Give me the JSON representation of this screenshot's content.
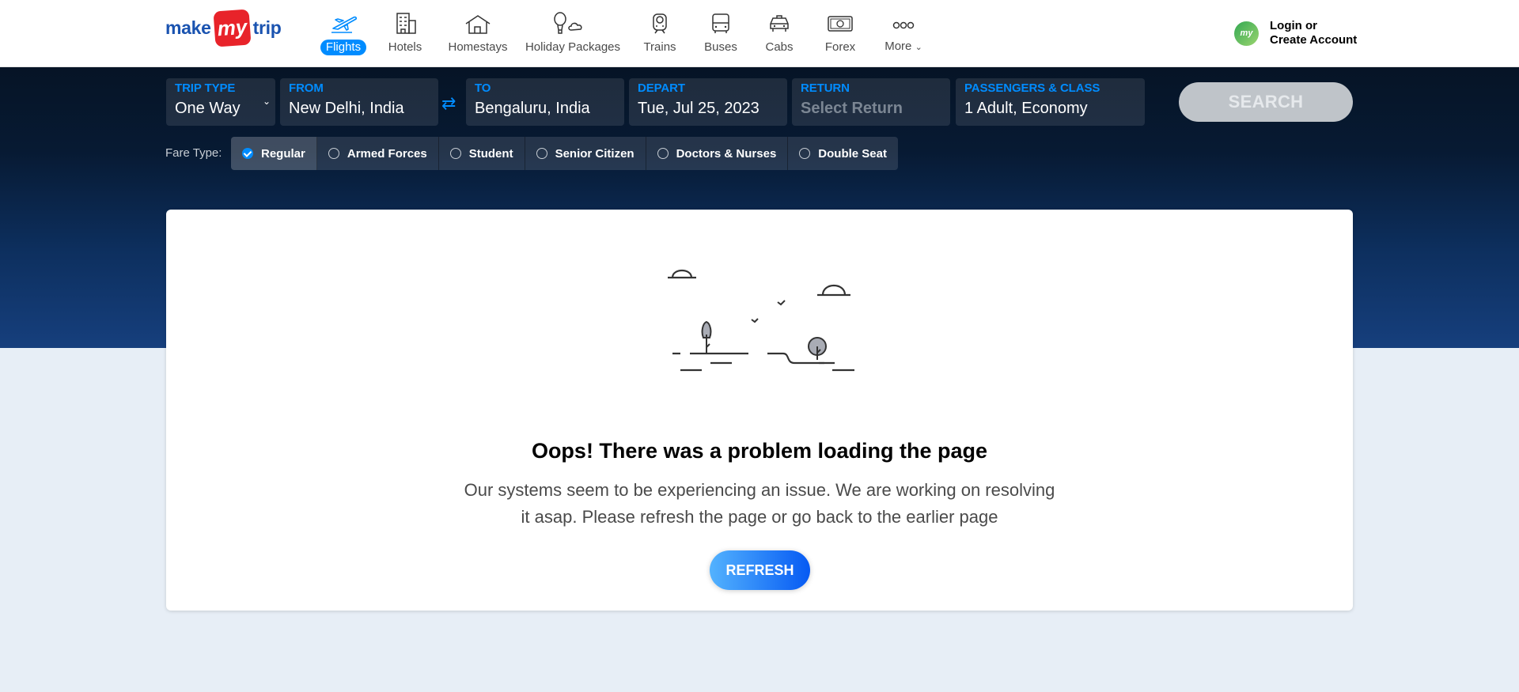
{
  "header": {
    "logo": {
      "make": "make",
      "my": "my",
      "trip": "trip"
    },
    "nav": [
      {
        "label": "Flights",
        "icon": "flight-icon",
        "active": true
      },
      {
        "label": "Hotels",
        "icon": "hotel-icon"
      },
      {
        "label": "Homestays",
        "icon": "homestay-icon"
      },
      {
        "label": "Holiday Packages",
        "icon": "holiday-packages-icon"
      },
      {
        "label": "Trains",
        "icon": "train-icon"
      },
      {
        "label": "Buses",
        "icon": "bus-icon"
      },
      {
        "label": "Cabs",
        "icon": "cab-icon"
      },
      {
        "label": "Forex",
        "icon": "forex-icon"
      },
      {
        "label": "More",
        "icon": "more-icon"
      }
    ],
    "account": {
      "avatar": "my",
      "line1": "Login or",
      "line2": "Create Account"
    }
  },
  "search": {
    "trip_type": {
      "label": "TRIP TYPE",
      "value": "One Way"
    },
    "from": {
      "label": "FROM",
      "value": "New Delhi, India"
    },
    "swap": "⇄",
    "to": {
      "label": "TO",
      "value": "Bengaluru, India"
    },
    "depart": {
      "label": "DEPART",
      "value": "Tue, Jul 25, 2023"
    },
    "return": {
      "label": "RETURN",
      "placeholder": "Select Return"
    },
    "passengers": {
      "label": "PASSENGERS & CLASS",
      "value": "1 Adult, Economy"
    },
    "button": "SEARCH"
  },
  "fare": {
    "label": "Fare Type:",
    "options": [
      "Regular",
      "Armed Forces",
      "Student",
      "Senior Citizen",
      "Doctors & Nurses",
      "Double Seat"
    ],
    "selected": "Regular"
  },
  "error": {
    "title": "Oops! There was a problem loading the page",
    "message": "Our systems seem to be experiencing an issue. We are working on resolving it asap. Please refresh the page or go back to the earlier page",
    "button": "REFRESH"
  },
  "colors": {
    "accent": "#008cff",
    "brand_red": "#e8232a",
    "brand_blue": "#1a53b0"
  }
}
